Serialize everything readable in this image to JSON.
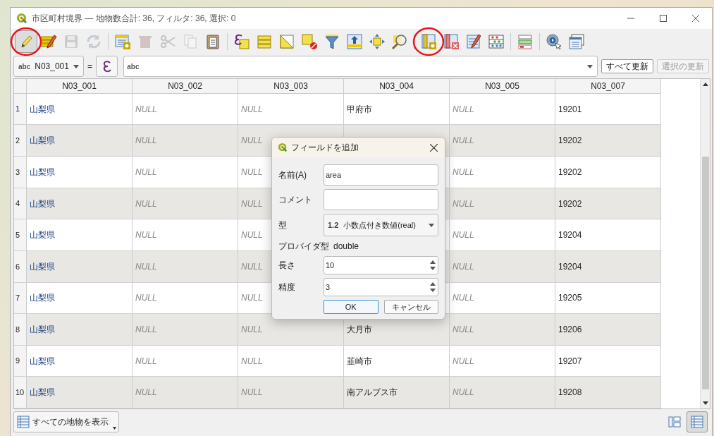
{
  "window": {
    "title": "市区町村境界 — 地物数合計: 36, フィルタ: 36, 選択: 0"
  },
  "toolbar": [
    {
      "kind": "toggle-edit",
      "disabled": false,
      "pressed": true,
      "highlighted": true
    },
    {
      "kind": "multi-edit",
      "disabled": false,
      "pressed": false,
      "highlighted": false
    },
    {
      "kind": "save",
      "disabled": true,
      "pressed": false,
      "highlighted": false
    },
    {
      "kind": "reload",
      "disabled": true,
      "pressed": false,
      "highlighted": false
    },
    {
      "kind": "separator"
    },
    {
      "kind": "add-feature",
      "disabled": false,
      "pressed": false,
      "highlighted": false
    },
    {
      "kind": "delete",
      "disabled": true,
      "pressed": false,
      "highlighted": false
    },
    {
      "kind": "cut",
      "disabled": true,
      "pressed": false,
      "highlighted": false
    },
    {
      "kind": "copy",
      "disabled": true,
      "pressed": false,
      "highlighted": false
    },
    {
      "kind": "paste",
      "disabled": false,
      "pressed": false,
      "highlighted": false
    },
    {
      "kind": "separator"
    },
    {
      "kind": "select-expression",
      "disabled": false,
      "pressed": false,
      "highlighted": false
    },
    {
      "kind": "select-all",
      "disabled": false,
      "pressed": false,
      "highlighted": false
    },
    {
      "kind": "invert",
      "disabled": false,
      "pressed": false,
      "highlighted": false
    },
    {
      "kind": "deselect",
      "disabled": false,
      "pressed": false,
      "highlighted": false
    },
    {
      "kind": "filter",
      "disabled": false,
      "pressed": false,
      "highlighted": false
    },
    {
      "kind": "move-top",
      "disabled": false,
      "pressed": false,
      "highlighted": false
    },
    {
      "kind": "pan",
      "disabled": false,
      "pressed": false,
      "highlighted": false
    },
    {
      "kind": "zoom",
      "disabled": false,
      "pressed": false,
      "highlighted": false
    },
    {
      "kind": "separator"
    },
    {
      "kind": "new-field",
      "disabled": false,
      "pressed": false,
      "highlighted": true
    },
    {
      "kind": "delete-field",
      "disabled": false,
      "pressed": false,
      "highlighted": false
    },
    {
      "kind": "organize-columns",
      "disabled": false,
      "pressed": false,
      "highlighted": false
    },
    {
      "kind": "calculator",
      "disabled": false,
      "pressed": false,
      "highlighted": false
    },
    {
      "kind": "separator"
    },
    {
      "kind": "conditional-format",
      "disabled": false,
      "pressed": false,
      "highlighted": false
    },
    {
      "kind": "separator"
    },
    {
      "kind": "actions",
      "disabled": false,
      "pressed": false,
      "highlighted": false
    },
    {
      "kind": "dock",
      "disabled": false,
      "pressed": false,
      "highlighted": false
    }
  ],
  "filter_bar": {
    "field_type": "abc",
    "field": "N03_001",
    "operator": "=",
    "expression_type": "abc",
    "buttons": [
      {
        "label": "すべて更新",
        "disabled": false
      },
      {
        "label": "選択の更新",
        "disabled": true
      }
    ]
  },
  "table": {
    "columns": [
      "N03_001",
      "N03_002",
      "N03_003",
      "N03_004",
      "N03_005",
      "N03_007"
    ],
    "rows": [
      {
        "number": "1",
        "cells": [
          {
            "kind": "pref",
            "text": "山梨県"
          },
          {
            "kind": "null",
            "text": "NULL"
          },
          {
            "kind": "null",
            "text": "NULL"
          },
          {
            "kind": "value",
            "text": "甲府市"
          },
          {
            "kind": "null",
            "text": "NULL"
          },
          {
            "kind": "value",
            "text": "19201"
          }
        ]
      },
      {
        "number": "2",
        "cells": [
          {
            "kind": "pref",
            "text": "山梨県"
          },
          {
            "kind": "null",
            "text": "NULL"
          },
          {
            "kind": "null",
            "text": "NULL"
          },
          {
            "kind": "covered"
          },
          {
            "kind": "null",
            "text": "NULL"
          },
          {
            "kind": "value",
            "text": "19202"
          }
        ]
      },
      {
        "number": "3",
        "cells": [
          {
            "kind": "pref",
            "text": "山梨県"
          },
          {
            "kind": "null",
            "text": "NULL"
          },
          {
            "kind": "null",
            "text": "NULL"
          },
          {
            "kind": "covered"
          },
          {
            "kind": "null",
            "text": "NULL"
          },
          {
            "kind": "value",
            "text": "19202"
          }
        ]
      },
      {
        "number": "4",
        "cells": [
          {
            "kind": "pref",
            "text": "山梨県"
          },
          {
            "kind": "null",
            "text": "NULL"
          },
          {
            "kind": "null",
            "text": "NULL"
          },
          {
            "kind": "covered"
          },
          {
            "kind": "null",
            "text": "NULL"
          },
          {
            "kind": "value",
            "text": "19202"
          }
        ]
      },
      {
        "number": "5",
        "cells": [
          {
            "kind": "pref",
            "text": "山梨県"
          },
          {
            "kind": "null",
            "text": "NULL"
          },
          {
            "kind": "null",
            "text": "NULL"
          },
          {
            "kind": "covered"
          },
          {
            "kind": "null",
            "text": "NULL"
          },
          {
            "kind": "value",
            "text": "19204"
          }
        ]
      },
      {
        "number": "6",
        "cells": [
          {
            "kind": "pref",
            "text": "山梨県"
          },
          {
            "kind": "null",
            "text": "NULL"
          },
          {
            "kind": "null",
            "text": "NULL"
          },
          {
            "kind": "covered"
          },
          {
            "kind": "null",
            "text": "NULL"
          },
          {
            "kind": "value",
            "text": "19204"
          }
        ]
      },
      {
        "number": "7",
        "cells": [
          {
            "kind": "pref",
            "text": "山梨県"
          },
          {
            "kind": "null",
            "text": "NULL"
          },
          {
            "kind": "null",
            "text": "NULL"
          },
          {
            "kind": "covered"
          },
          {
            "kind": "null",
            "text": "NULL"
          },
          {
            "kind": "value",
            "text": "19205"
          }
        ]
      },
      {
        "number": "8",
        "cells": [
          {
            "kind": "pref",
            "text": "山梨県"
          },
          {
            "kind": "null",
            "text": "NULL"
          },
          {
            "kind": "null",
            "text": "NULL"
          },
          {
            "kind": "value",
            "text": "大月市"
          },
          {
            "kind": "null",
            "text": "NULL"
          },
          {
            "kind": "value",
            "text": "19206"
          }
        ]
      },
      {
        "number": "9",
        "cells": [
          {
            "kind": "pref",
            "text": "山梨県"
          },
          {
            "kind": "null",
            "text": "NULL"
          },
          {
            "kind": "null",
            "text": "NULL"
          },
          {
            "kind": "value",
            "text": "韮崎市"
          },
          {
            "kind": "null",
            "text": "NULL"
          },
          {
            "kind": "value",
            "text": "19207"
          }
        ]
      },
      {
        "number": "10",
        "cells": [
          {
            "kind": "pref",
            "text": "山梨県"
          },
          {
            "kind": "null",
            "text": "NULL"
          },
          {
            "kind": "null",
            "text": "NULL"
          },
          {
            "kind": "value",
            "text": "南アルプス市"
          },
          {
            "kind": "null",
            "text": "NULL"
          },
          {
            "kind": "value",
            "text": "19208"
          }
        ]
      }
    ]
  },
  "dialog": {
    "title": "フィールドを追加",
    "fields": [
      {
        "kind": "text",
        "label": "名前(A)",
        "value": "area"
      },
      {
        "kind": "text",
        "label": "コメント"
      },
      {
        "kind": "combo",
        "label": "型",
        "code": "1.2",
        "value": "小数点付き数値(real)"
      },
      {
        "kind": "info",
        "label": "プロバイダ型",
        "value": "double"
      },
      {
        "kind": "spin",
        "label": "長さ",
        "value": "10"
      },
      {
        "kind": "spin",
        "label": "精度",
        "value": "3"
      }
    ],
    "buttons": [
      {
        "label": "OK",
        "default": true
      },
      {
        "label": "キャンセル",
        "default": false
      }
    ]
  },
  "bottom_bar": {
    "show_button": "すべての地物を表示",
    "views": [
      {
        "kind": "form",
        "selected": false
      },
      {
        "kind": "table",
        "selected": true
      }
    ]
  }
}
